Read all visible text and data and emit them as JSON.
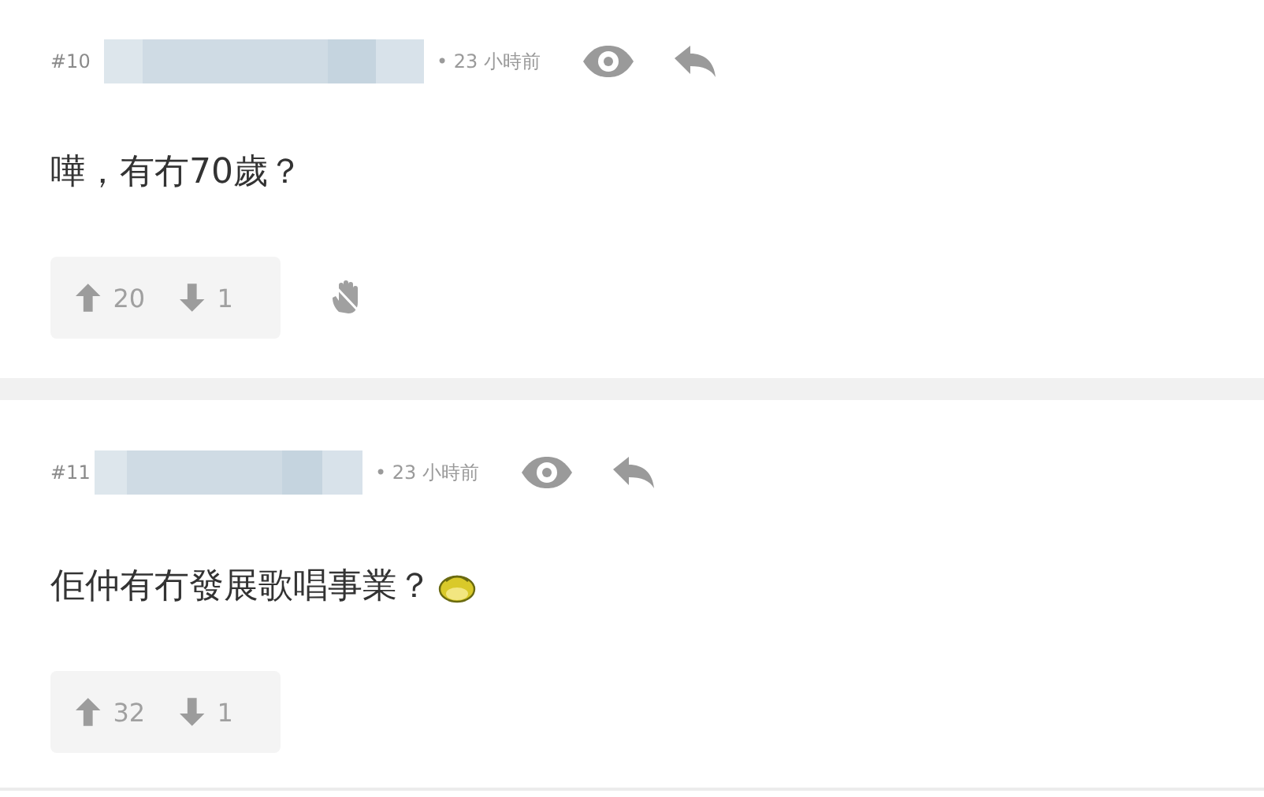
{
  "posts": [
    {
      "number": "#10",
      "time": "• 23 小時前",
      "body": "嘩，有冇70歲？",
      "has_emoji": false,
      "upvotes": "20",
      "downvotes": "1",
      "show_hide_button": true
    },
    {
      "number": "#11",
      "time": "• 23 小時前",
      "body": "佢仲有冇發展歌唱事業？",
      "has_emoji": true,
      "upvotes": "32",
      "downvotes": "1",
      "show_hide_button": false
    }
  ]
}
